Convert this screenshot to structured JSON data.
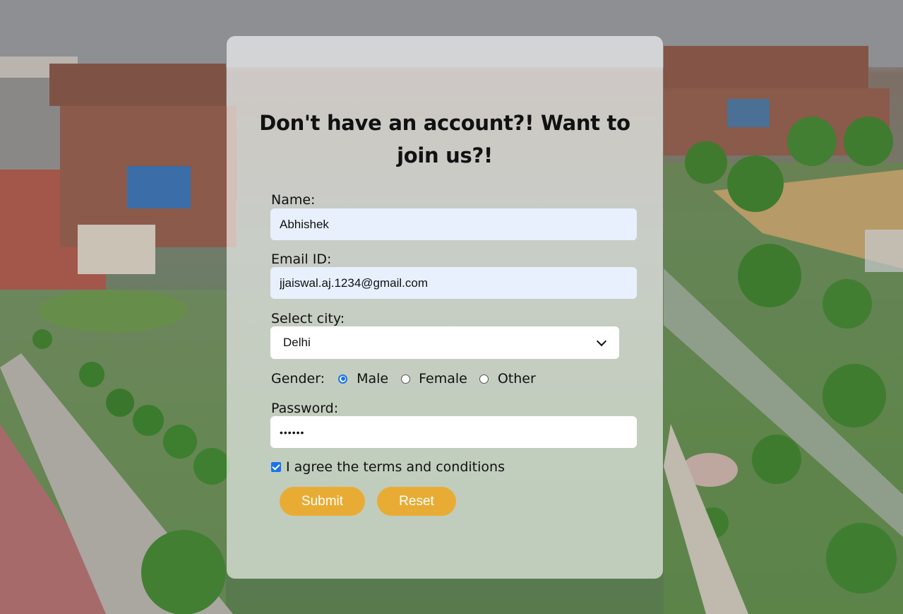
{
  "form": {
    "title": "Don't have an account?! Want to join us?!",
    "name": {
      "label": "Name:",
      "value": "Abhishek"
    },
    "email": {
      "label": "Email ID:",
      "value": "jjaiswal.aj.1234@gmail.com"
    },
    "city": {
      "label": "Select city:",
      "selected": "Delhi"
    },
    "gender": {
      "label": "Gender:",
      "options": [
        "Male",
        "Female",
        "Other"
      ],
      "selected": "Male"
    },
    "password": {
      "label": "Password:",
      "masked_value": "••••••"
    },
    "terms": {
      "label": "I agree the terms and conditions",
      "checked": true
    },
    "buttons": {
      "submit": "Submit",
      "reset": "Reset"
    }
  },
  "colors": {
    "button_bg": "#e8ac35",
    "autofill_bg": "#e8f0fe",
    "accent": "#1a73e8"
  }
}
